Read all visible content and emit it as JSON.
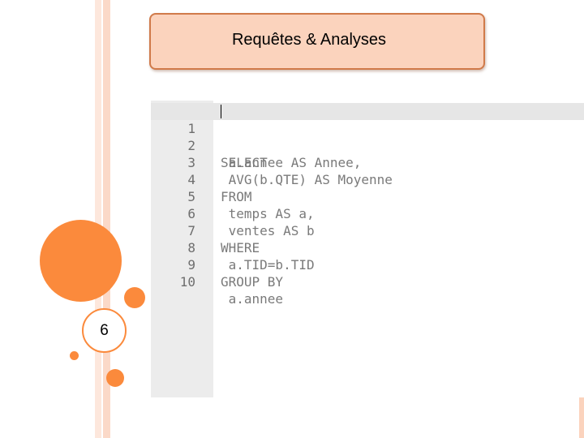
{
  "slide": {
    "title": "Requêtes & Analyses",
    "page_number": "6"
  },
  "editor": {
    "lines": [
      {
        "number": "1",
        "code": "SELECT"
      },
      {
        "number": "2",
        "code": " a.annee AS Annee,"
      },
      {
        "number": "3",
        "code": " AVG(b.QTE) AS Moyenne"
      },
      {
        "number": "4",
        "code": "FROM"
      },
      {
        "number": "5",
        "code": " temps AS a,"
      },
      {
        "number": "6",
        "code": " ventes AS b"
      },
      {
        "number": "7",
        "code": "WHERE"
      },
      {
        "number": "8",
        "code": " a.TID=b.TID"
      },
      {
        "number": "9",
        "code": "GROUP BY"
      },
      {
        "number": "10",
        "code": " a.annee"
      }
    ]
  },
  "colors": {
    "accent": "#fb8a3c",
    "title_fill": "#fbd3bd",
    "title_border": "#d07a4a"
  }
}
